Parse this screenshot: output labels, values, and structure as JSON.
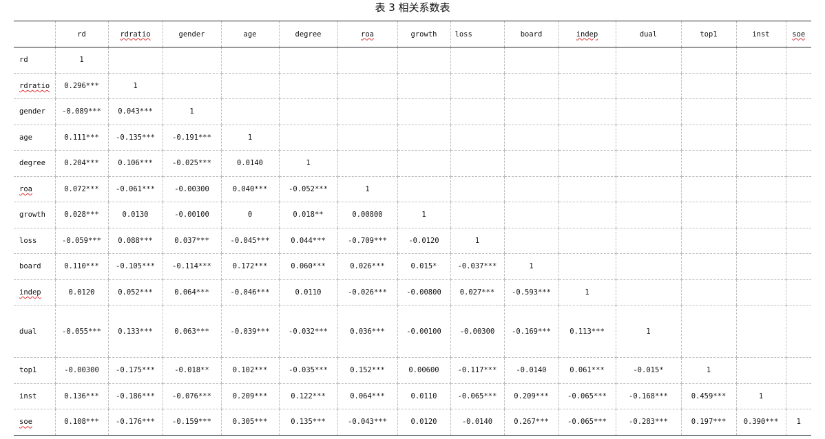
{
  "title": "表 3 相关系数表",
  "columns": [
    "rd",
    "rdratio",
    "gender",
    "age",
    "degree",
    "roa",
    "growth",
    "loss",
    "board",
    "indep",
    "dual",
    "top1",
    "inst",
    "soe"
  ],
  "rows": [
    {
      "label": "rd",
      "cells": [
        "1",
        "",
        "",
        "",
        "",
        "",
        "",
        "",
        "",
        "",
        "",
        "",
        "",
        ""
      ]
    },
    {
      "label": "rdratio",
      "cells": [
        "0.296***",
        "1",
        "",
        "",
        "",
        "",
        "",
        "",
        "",
        "",
        "",
        "",
        "",
        ""
      ]
    },
    {
      "label": "gender",
      "cells": [
        "-0.089***",
        "0.043***",
        "1",
        "",
        "",
        "",
        "",
        "",
        "",
        "",
        "",
        "",
        "",
        ""
      ]
    },
    {
      "label": "age",
      "cells": [
        "0.111***",
        "-0.135***",
        "-0.191***",
        "1",
        "",
        "",
        "",
        "",
        "",
        "",
        "",
        "",
        "",
        ""
      ]
    },
    {
      "label": "degree",
      "cells": [
        "0.204***",
        "0.106***",
        "-0.025***",
        "0.0140",
        "1",
        "",
        "",
        "",
        "",
        "",
        "",
        "",
        "",
        ""
      ]
    },
    {
      "label": "roa",
      "cells": [
        "0.072***",
        "-0.061***",
        "-0.00300",
        "0.040***",
        "-0.052***",
        "1",
        "",
        "",
        "",
        "",
        "",
        "",
        "",
        ""
      ]
    },
    {
      "label": "growth",
      "cells": [
        "0.028***",
        "0.0130",
        "-0.00100",
        "0",
        "0.018**",
        "0.00800",
        "1",
        "",
        "",
        "",
        "",
        "",
        "",
        ""
      ]
    },
    {
      "label": "loss",
      "cells": [
        "-0.059***",
        "0.088***",
        "0.037***",
        "-0.045***",
        "0.044***",
        "-0.709***",
        "-0.0120",
        "1",
        "",
        "",
        "",
        "",
        "",
        ""
      ]
    },
    {
      "label": "board",
      "cells": [
        "0.110***",
        "-0.105***",
        "-0.114***",
        "0.172***",
        "0.060***",
        "0.026***",
        "0.015*",
        "-0.037***",
        "1",
        "",
        "",
        "",
        "",
        ""
      ]
    },
    {
      "label": "indep",
      "cells": [
        "0.0120",
        "0.052***",
        "0.064***",
        "-0.046***",
        "0.0110",
        "-0.026***",
        "-0.00800",
        "0.027***",
        "-0.593***",
        "1",
        "",
        "",
        "",
        ""
      ]
    },
    {
      "label": "dual",
      "cells": [
        "-0.055***",
        "0.133***",
        "0.063***",
        "-0.039***",
        "-0.032***",
        "0.036***",
        "-0.00100",
        "-0.00300",
        "-0.169***",
        "0.113***",
        "1",
        "",
        "",
        ""
      ]
    },
    {
      "label": "top1",
      "cells": [
        "-0.00300",
        "-0.175***",
        "-0.018**",
        "0.102***",
        "-0.035***",
        "0.152***",
        "0.00600",
        "-0.117***",
        "-0.0140",
        "0.061***",
        "-0.015*",
        "1",
        "",
        ""
      ]
    },
    {
      "label": "inst",
      "cells": [
        "0.136***",
        "-0.186***",
        "-0.076***",
        "0.209***",
        "0.122***",
        "0.064***",
        "0.0110",
        "-0.065***",
        "0.209***",
        "-0.065***",
        "-0.168***",
        "0.459***",
        "1",
        ""
      ]
    },
    {
      "label": "soe",
      "cells": [
        "0.108***",
        "-0.176***",
        "-0.159***",
        "0.305***",
        "0.135***",
        "-0.043***",
        "0.0120",
        "-0.0140",
        "0.267***",
        "-0.065***",
        "-0.283***",
        "0.197***",
        "0.390***",
        "1"
      ]
    }
  ]
}
